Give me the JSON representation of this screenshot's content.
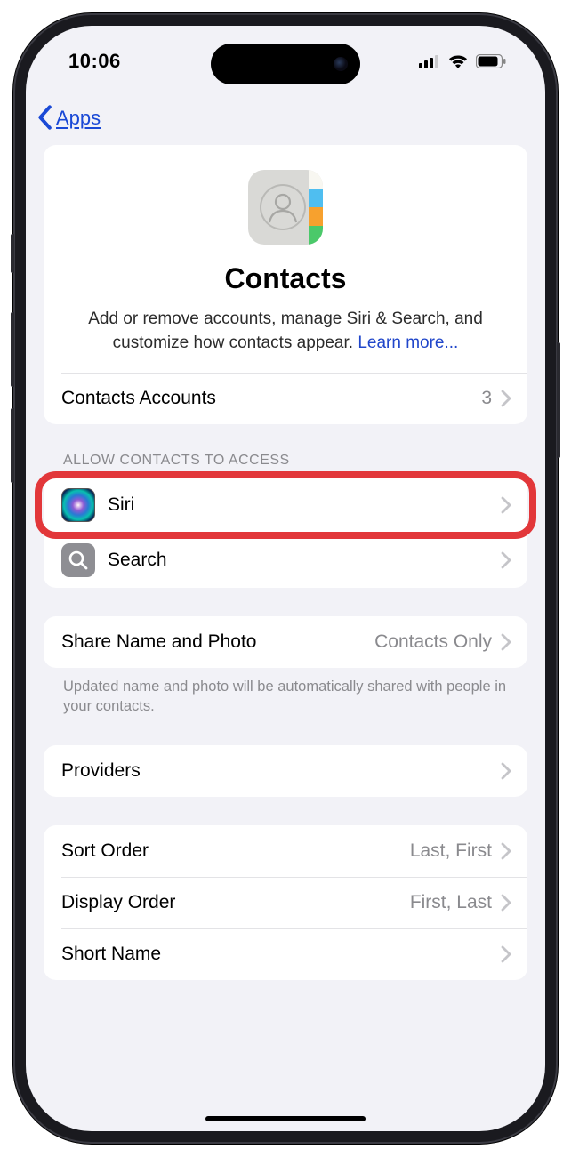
{
  "status": {
    "time": "10:06"
  },
  "nav": {
    "back_label": "Apps"
  },
  "hero": {
    "title": "Contacts",
    "description_prefix": "Add or remove accounts, manage Siri & Search, and customize how contacts appear. ",
    "learn_more": "Learn more..."
  },
  "accounts": {
    "label": "Contacts Accounts",
    "value": "3"
  },
  "access": {
    "header": "ALLOW CONTACTS TO ACCESS",
    "siri_label": "Siri",
    "search_label": "Search"
  },
  "share": {
    "label": "Share Name and Photo",
    "value": "Contacts Only",
    "footer": "Updated name and photo will be automatically shared with people in your contacts."
  },
  "providers": {
    "label": "Providers"
  },
  "order": {
    "sort_label": "Sort Order",
    "sort_value": "Last, First",
    "display_label": "Display Order",
    "display_value": "First, Last",
    "short_name_label": "Short Name"
  }
}
